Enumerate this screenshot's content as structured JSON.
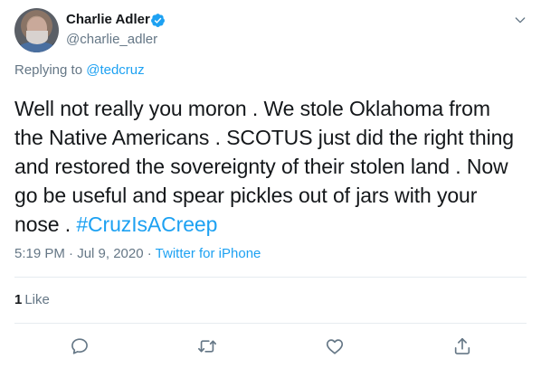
{
  "author": {
    "display_name": "Charlie Adler",
    "handle": "@charlie_adler",
    "verified": true
  },
  "reply": {
    "prefix": "Replying to ",
    "to": "@tedcruz"
  },
  "tweet": {
    "text": "Well not really you moron . We stole Oklahoma from the Native Americans . SCOTUS just did the right thing and restored the sovereignty of their stolen land . Now go be useful and spear pickles out of jars with your nose . ",
    "hashtag": "#CruzIsACreep"
  },
  "meta": {
    "time": "5:19 PM · Jul 9, 2020",
    "separator": " · ",
    "source": "Twitter for iPhone"
  },
  "stats": {
    "like_count": "1",
    "like_label": "Like"
  },
  "actions": [
    "reply-icon",
    "retweet-icon",
    "like-icon",
    "share-icon"
  ],
  "colors": {
    "accent": "#1da1f2",
    "secondary_text": "#657786",
    "divider": "#e6ecf0"
  }
}
